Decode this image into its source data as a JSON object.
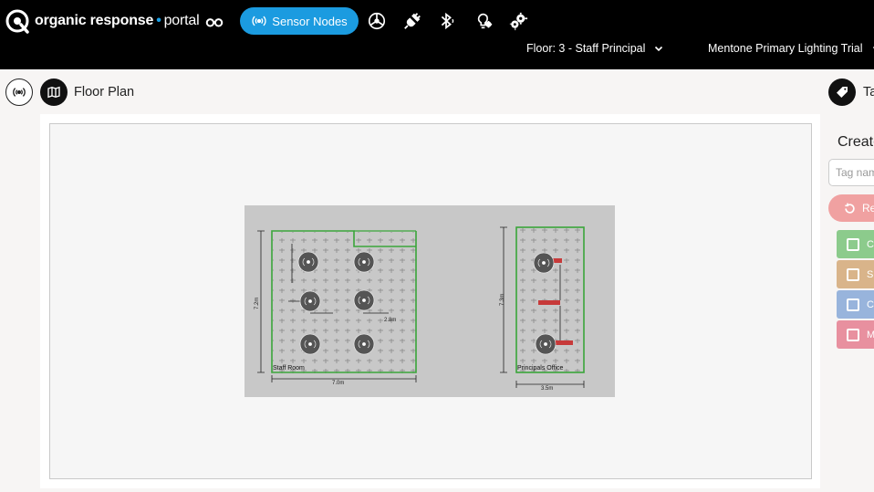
{
  "app": {
    "brand_part1": "organic response",
    "brand_sep": "•",
    "brand_part2": "portal"
  },
  "nav": {
    "active_label": "Sensor Nodes",
    "icons": [
      "glasses-icon",
      "sensor-nodes-icon",
      "dashboard-gauge-icon",
      "plug-icon",
      "bluetooth-icon",
      "light-bulb-gear-icon",
      "gears-icon"
    ]
  },
  "selectors": {
    "floor": "Floor: 3 - Staff Principal",
    "site": "Mentone Primary Lighting Trial"
  },
  "page": {
    "title": "Floor Plan",
    "tags_title": "Ta"
  },
  "floor_plan": {
    "rooms": [
      {
        "name": "Staff Room",
        "height_dim": "7.2m",
        "width_dim": "7.0m",
        "sub_dim": "2.8m"
      },
      {
        "name": "Principals Office",
        "height_dim": "7.3m",
        "width_dim": "3.5m"
      }
    ]
  },
  "tags_panel": {
    "create_title": "Create",
    "input_placeholder": "Tag nam",
    "reset_label": "Re",
    "tags": [
      {
        "label": "C",
        "color": "#8ccb8c"
      },
      {
        "label": "S",
        "color": "#d9b48a"
      },
      {
        "label": "C",
        "color": "#98b4dc"
      },
      {
        "label": "M",
        "color": "#e8909f"
      }
    ]
  },
  "colors": {
    "accent": "#1b9be0",
    "topbar": "#000000",
    "room_outline": "#3aa63a",
    "sensor_node": "#555555"
  }
}
